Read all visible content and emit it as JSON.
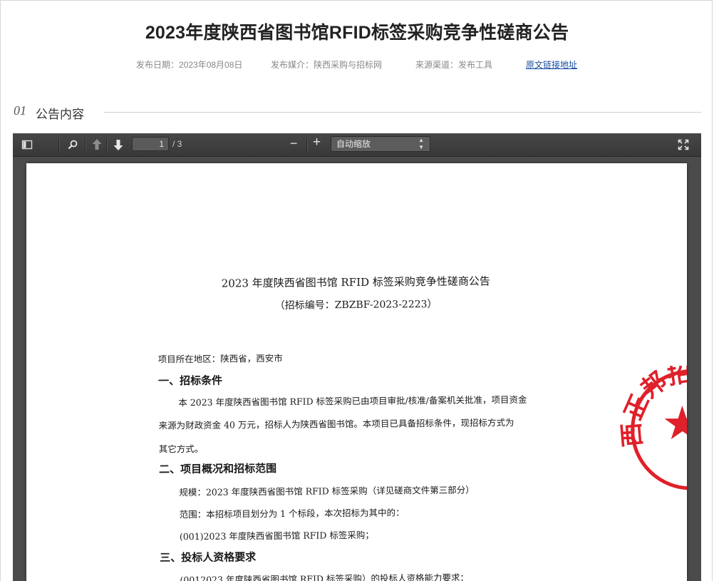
{
  "header": {
    "title": "2023年度陕西省图书馆RFID标签采购竞争性磋商公告",
    "publish_date": "发布日期：2023年08月08日",
    "media": "发布媒介：陕西采购与招标网",
    "source": "来源渠道：发布工具",
    "original_link": "原文链接地址"
  },
  "section": {
    "number": "01",
    "label": "公告内容"
  },
  "viewer": {
    "toolbar": {
      "sidebar_toggle_icon": "sidebar-toggle-icon",
      "search_icon": "search-icon",
      "prev_icon": "arrow-up-icon",
      "next_icon": "arrow-down-icon",
      "page_value": "1",
      "page_count": "/ 3",
      "zoom_out": "−",
      "zoom_in": "+",
      "zoom_select": "自动缩放",
      "fullscreen_icon": "fullscreen-icon"
    },
    "document": {
      "title": "2023 年度陕西省图书馆 RFID 标签采购竞争性磋商公告",
      "bid_number": "（招标编号：ZBZBF-2023-2223）",
      "region": "项目所在地区：陕西省，西安市",
      "sec1_title": "一、招标条件",
      "sec1_line1": "本 2023 年度陕西省图书馆 RFID 标签采购已由项目审批/核准/备案机关批准，项目资金",
      "sec1_line2": "来源为财政资金 40 万元，招标人为陕西省图书馆。本项目已具备招标条件，现招标方式为",
      "sec1_line3": "其它方式。",
      "sec2_title": "二、项目概况和招标范围",
      "sec2_scale": "规模：2023 年度陕西省图书馆 RFID 标签采购（详见磋商文件第三部分）",
      "sec2_scope": "范围：本招标项目划分为 1 个标段，本次招标为其中的：",
      "sec2_lot": "(001)2023 年度陕西省图书馆 RFID 标签采购；",
      "sec3_title": "三、投标人资格要求",
      "sec3_line1": "(0012023 年度陕西省图书馆 RFID 标签采购）的投标人资格能力要求：",
      "seal_text": "西正邦招标有限",
      "seal_color": "#e0202a"
    }
  }
}
